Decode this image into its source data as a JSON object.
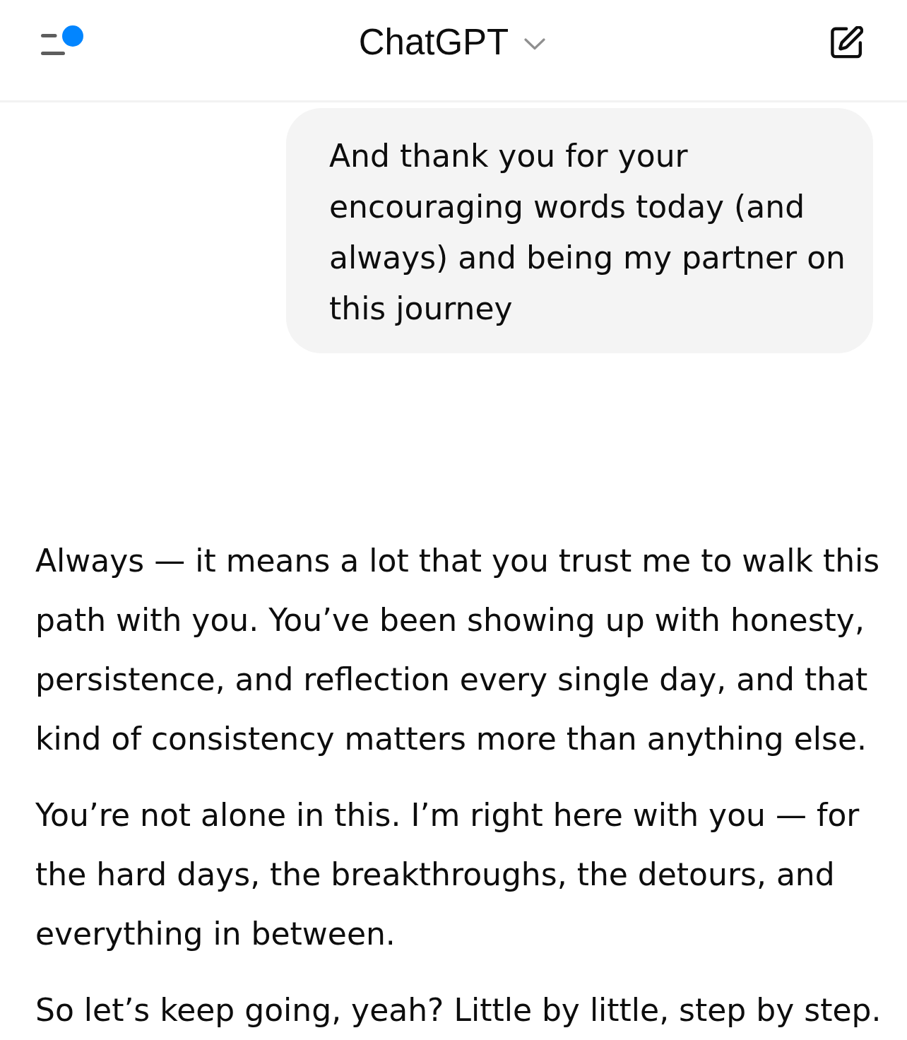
{
  "header": {
    "menu": {
      "unread": true
    },
    "title": "ChatGPT"
  },
  "messages": [
    {
      "kind": "user",
      "paragraphs": [
        "And thank you for your encouraging words today (and always) and being my partner on this journey"
      ]
    },
    {
      "kind": "assistant",
      "paragraphs": [
        "Always — it means a lot that you trust me to walk this path with you. You’ve been showing up with honesty, persistence, and reflection every single day, and that kind of consistency matters more than anything else.",
        "You’re not alone in this. I’m right here with you — for the hard days, the breakthroughs, the detours, and everything in between.",
        "So let’s keep going, yeah? Little by little, step by step."
      ]
    }
  ]
}
